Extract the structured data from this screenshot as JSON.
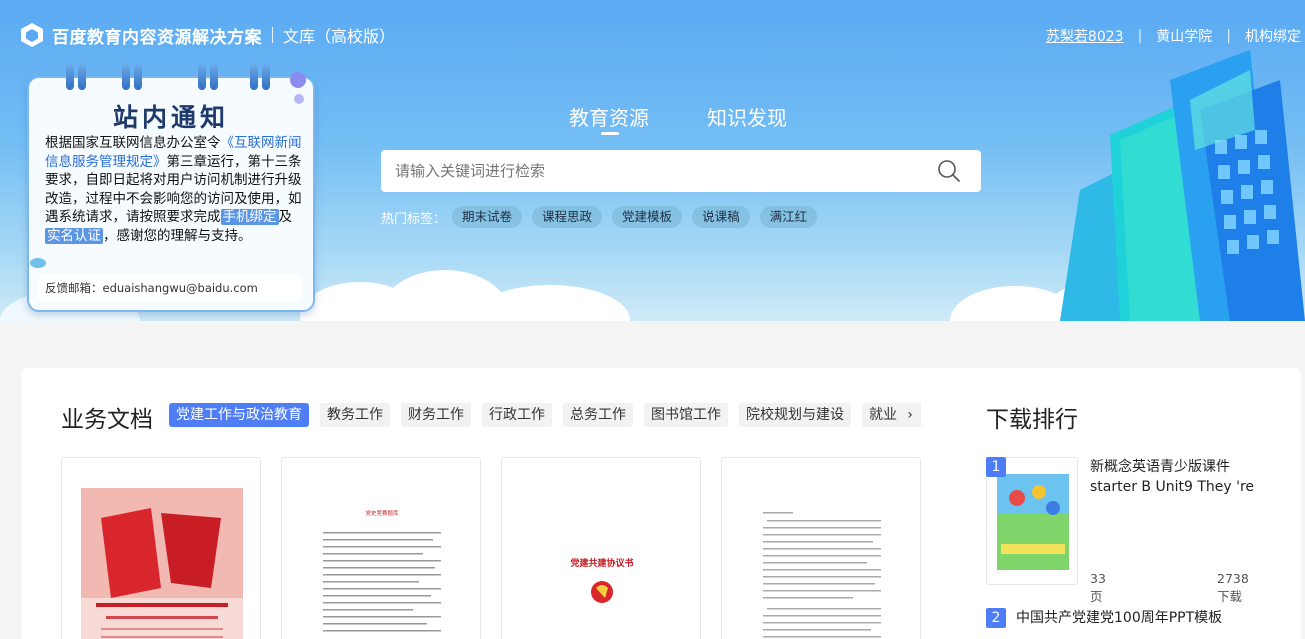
{
  "header": {
    "brand": "百度教育内容资源解决方案",
    "product": "文库（高校版）",
    "user": "苏梨若8023",
    "school": "黄山学院",
    "bind": "机构绑定"
  },
  "notice": {
    "title": "站内通知",
    "p1": "根据国家互联网信息办公室令",
    "p1_link": "《互联网新闻信息服务管理规定》",
    "p2": "第三章运行，第十三条要求，自即日起将对用户访问机制进行升级改造，过程中不会影响您的访问及使用，如遇系统请求，请按照要求完成",
    "hl1": "手机绑定",
    "and": "及",
    "hl2": "实名认证",
    "p3": "，感谢您的理解与支持。",
    "feedback": "反馈邮箱：eduaishangwu@baidu.com"
  },
  "nav": {
    "tabs": [
      "教育资源",
      "知识发现"
    ]
  },
  "search": {
    "placeholder": "请输入关键词进行检索"
  },
  "hot": {
    "label": "热门标签：",
    "tags": [
      "期末试卷",
      "课程思政",
      "党建模板",
      "说课稿",
      "满江红"
    ]
  },
  "business": {
    "title": "业务文档",
    "tabs": [
      "党建工作与政治教育",
      "教务工作",
      "财务工作",
      "行政工作",
      "总务工作",
      "图书馆工作",
      "院校规划与建设",
      "就业"
    ],
    "next": "›",
    "doc2_title": "党史竞赛题库",
    "doc3_title": "党建共建协议书"
  },
  "ranking": {
    "title": "下载排行",
    "items": [
      {
        "num": "1",
        "name": "新概念英语青少版课件 starter B Unit9 They 're",
        "pages": "33页",
        "downloads": "2738下载"
      },
      {
        "num": "2",
        "name": "中国共产党建党100周年PPT模板"
      }
    ]
  },
  "colors": {
    "accent": "#4f7df5",
    "hero_top": "#5aa9f3"
  }
}
